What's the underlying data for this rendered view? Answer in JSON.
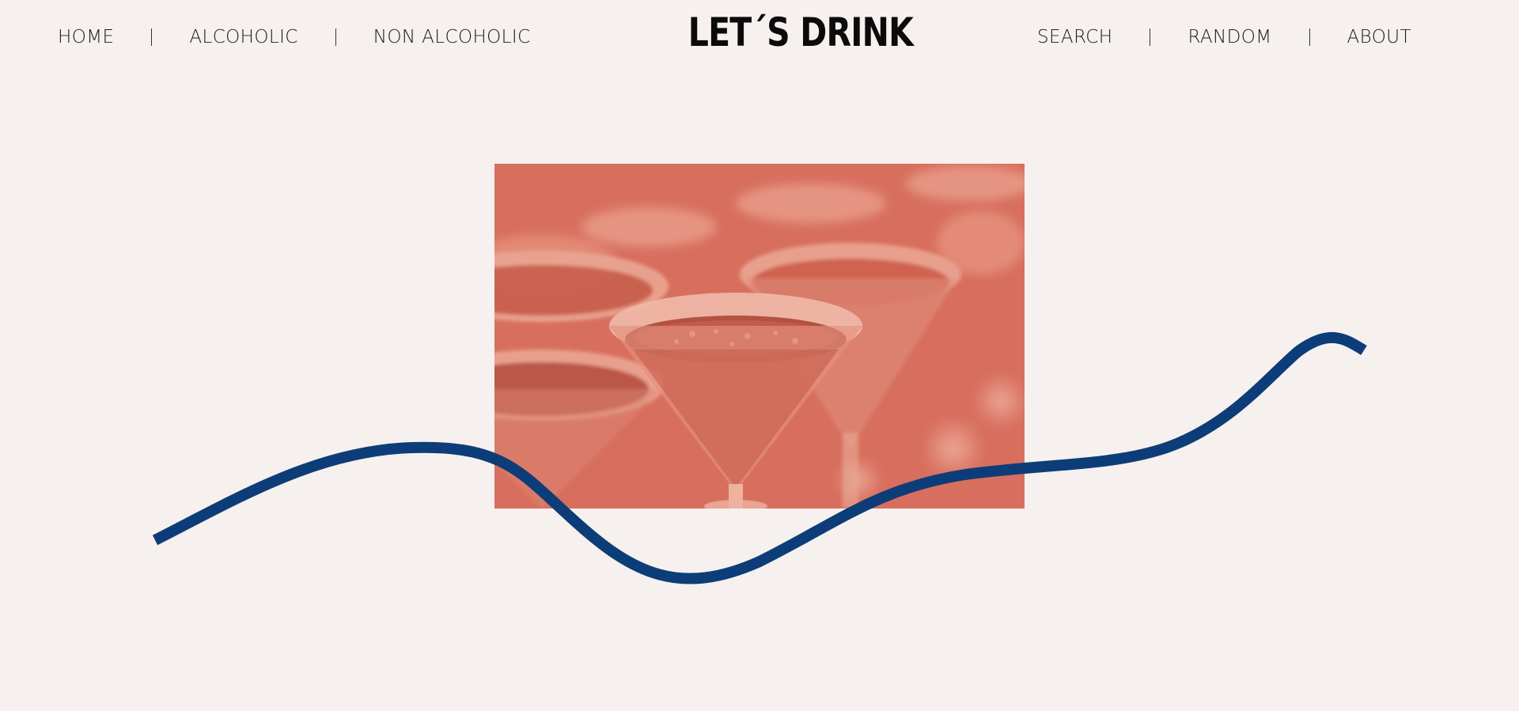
{
  "nav": {
    "left": [
      {
        "label": "HOME"
      },
      {
        "label": "ALCOHOLIC"
      },
      {
        "label": "NON ALCOHOLIC"
      }
    ],
    "right": [
      {
        "label": "SEARCH"
      },
      {
        "label": "RANDOM"
      },
      {
        "label": "ABOUT"
      }
    ]
  },
  "brand": {
    "title": "LET´S DRINK"
  },
  "colors": {
    "background": "#f6f1ee",
    "image_tint": "#d9705f",
    "wave": "#0d3d78",
    "text": "#1a1a1a"
  },
  "hero": {
    "icon": "cocktail-glasses-image"
  },
  "decoration": {
    "icon": "wave-line-icon"
  }
}
